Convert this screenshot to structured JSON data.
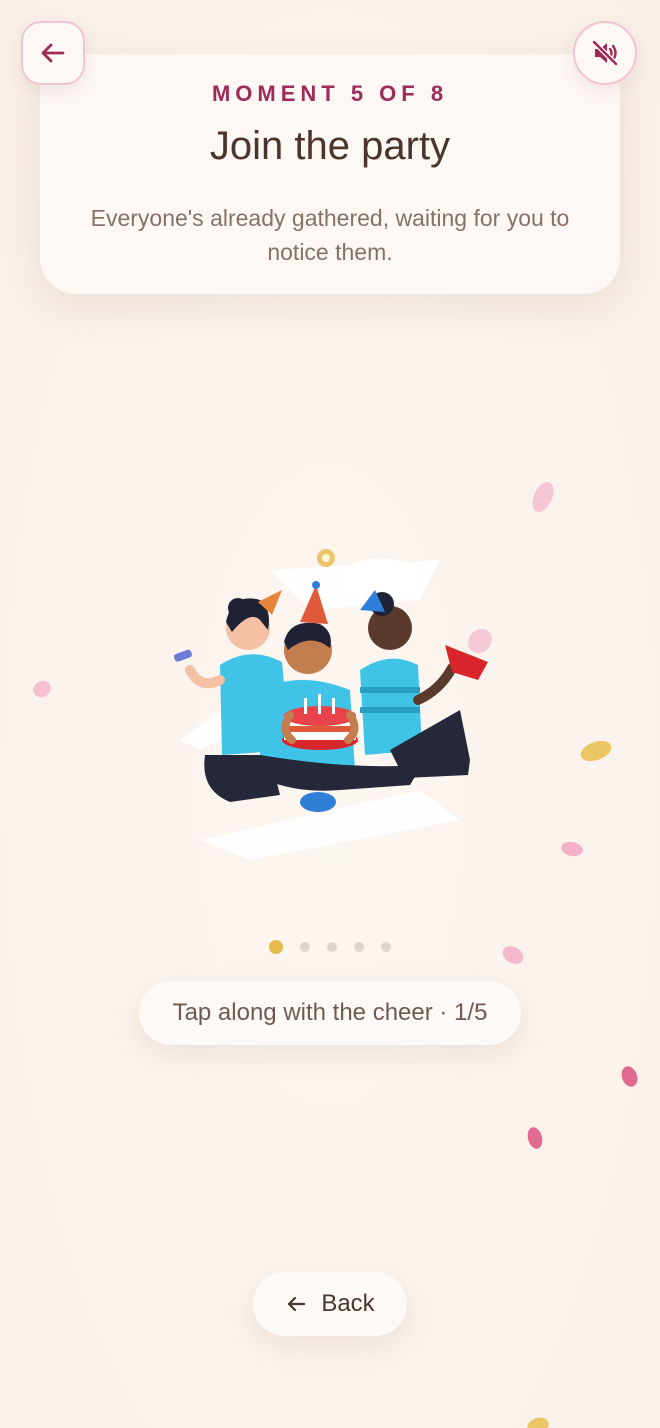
{
  "header": {
    "eyebrow": "MOMENT 5 OF 8",
    "title": "Join the party",
    "subtitle": "Everyone's already gathered, waiting for you to notice them."
  },
  "controls": {
    "back_icon": "arrow-left-icon",
    "mute_icon": "speaker-muted-icon"
  },
  "illustration": {
    "subject": "party-friends-with-cake"
  },
  "progress": {
    "total_dots": 5,
    "active_index": 0
  },
  "cheer": {
    "label": "Tap along with the cheer · 1/5"
  },
  "footer": {
    "back_label": "Back"
  },
  "colors": {
    "accent": "#9c2b58",
    "title": "#4a342c",
    "body": "#867169",
    "dot_active": "#e5b94a",
    "petal_pink": "#f3b7cc",
    "petal_rose": "#e0698f",
    "petal_gold": "#e9c46a"
  }
}
